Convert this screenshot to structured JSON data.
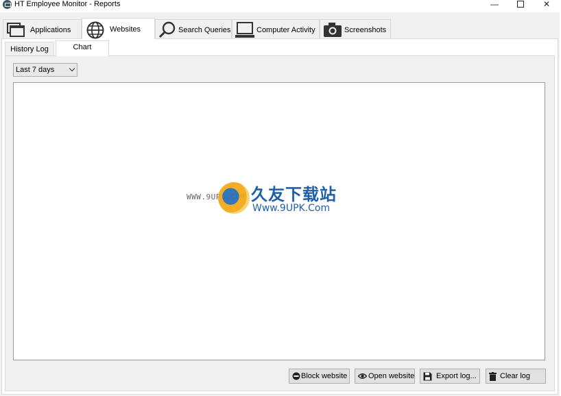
{
  "window": {
    "title": "HT Employee Monitor - Reports",
    "minimize_glyph": "—",
    "close_glyph": "✕"
  },
  "main_tabs": [
    {
      "label": "Applications",
      "icon": "windows-icon"
    },
    {
      "label": "Websites",
      "icon": "globe-icon"
    },
    {
      "label": "Search Queries",
      "icon": "magnifier-icon"
    },
    {
      "label": "Computer Activity",
      "icon": "laptop-icon"
    },
    {
      "label": "Screenshots",
      "icon": "camera-icon"
    }
  ],
  "active_main_tab": "Websites",
  "sub_tabs": [
    {
      "label": "History Log"
    },
    {
      "label": "Chart"
    }
  ],
  "active_sub_tab": "Chart",
  "period": {
    "selected": "Last 7 days"
  },
  "watermark": {
    "url": "WWW.9UPK.COM",
    "cn": "久友下载站",
    "en": "Www.9UPK.Com"
  },
  "buttons": {
    "block_website": {
      "label": "Block website",
      "icon": "block-icon"
    },
    "open_website": {
      "label": "Open website",
      "icon": "eye-icon"
    },
    "export_log": {
      "label": "Export log...",
      "icon": "floppy-icon"
    },
    "clear_log": {
      "label": "Clear log",
      "icon": "trash-icon"
    }
  },
  "colors": {
    "panel_bg": "#f0f0f0",
    "border": "#d9d9d9",
    "button_bg": "#e1e1e1"
  }
}
